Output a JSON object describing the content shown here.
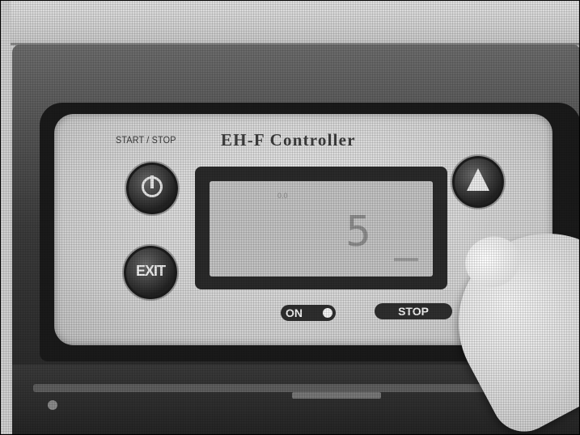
{
  "device": {
    "start_stop_label": "START / STOP",
    "title": "EH-F Controller",
    "lcd": {
      "top_text": "0.0",
      "digit": "5"
    },
    "buttons": {
      "exit_label": "EXIT",
      "on_label": "ON",
      "stop_label": "STOP"
    },
    "icons": {
      "start": "power-icon",
      "up": "up-arrow-icon",
      "on_indicator": "led-indicator"
    }
  }
}
